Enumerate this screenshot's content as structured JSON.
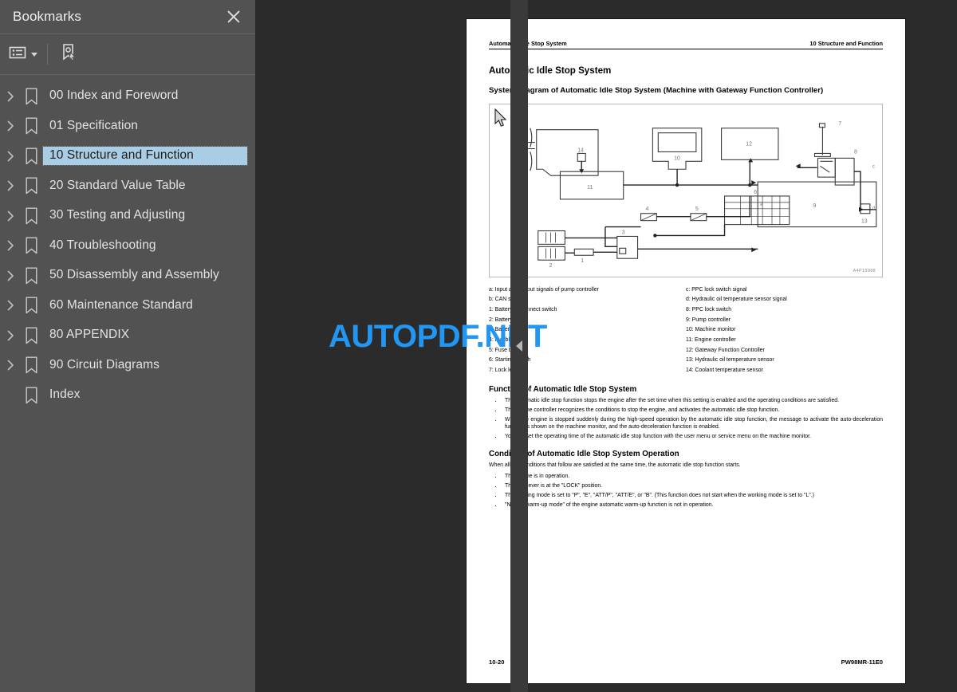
{
  "sidebar": {
    "title": "Bookmarks",
    "close_icon": "close-icon",
    "toolbar": {
      "options_label": "options-list-icon",
      "find_bookmark_label": "find-current-bookmark-icon"
    },
    "items": [
      {
        "label": "00 Index and Foreword",
        "expandable": true,
        "selected": false
      },
      {
        "label": "01 Specification",
        "expandable": true,
        "selected": false
      },
      {
        "label": "10 Structure and Function",
        "expandable": true,
        "selected": true
      },
      {
        "label": "20 Standard Value Table",
        "expandable": true,
        "selected": false
      },
      {
        "label": "30 Testing and Adjusting",
        "expandable": true,
        "selected": false
      },
      {
        "label": "40 Troubleshooting",
        "expandable": true,
        "selected": false
      },
      {
        "label": "50 Disassembly and Assembly",
        "expandable": true,
        "selected": false
      },
      {
        "label": "60 Maintenance Standard",
        "expandable": true,
        "selected": false
      },
      {
        "label": "80 APPENDIX",
        "expandable": true,
        "selected": false
      },
      {
        "label": "90 Circuit Diagrams",
        "expandable": true,
        "selected": false
      },
      {
        "label": "Index",
        "expandable": false,
        "selected": false
      }
    ]
  },
  "viewer": {
    "collapse_handle": "collapse-panel-handle",
    "watermark": "AUTOPDF.NET",
    "watermark_color": "#2196f3"
  },
  "document": {
    "running_header_left": "Automatic Idle Stop System",
    "running_header_right": "10 Structure and Function",
    "heading": "Automatic Idle Stop System",
    "subheading": "System Diagram of Automatic Idle Stop System (Machine with Gateway Function Controller)",
    "figure_code": "A4P15088",
    "legend_left": [
      "a: Input and output signals of pump controller",
      "b: CAN signal",
      "1: Battery disconnect switch",
      "2: Battery",
      "3: Battery relay",
      "4: Fusible link",
      "5: Fuse box",
      "6: Starting switch",
      "7: Lock lever"
    ],
    "legend_right": [
      "c: PPC lock switch signal",
      "d: Hydraulic oil temperature sensor signal",
      "8: PPC lock switch",
      "9: Pump controller",
      "10: Machine monitor",
      "11: Engine controller",
      "12: Gateway Function Controller",
      "13: Hydraulic oil temperature sensor",
      "14: Coolant temperature sensor"
    ],
    "function_heading": "Function of Automatic Idle Stop System",
    "function_bullets": [
      "The automatic idle stop function stops the engine after the set time when this setting is enabled and the operating conditions are satisfied.",
      "The engine controller recognizes the conditions to stop the engine, and activates the automatic idle stop function.",
      "When the engine is stopped suddenly during the high-speed operation by the automatic idle stop function, the message to activate the auto-deceleration function is shown on the machine monitor, and the auto-deceleration function is enabled.",
      "You can set the operating time of the automatic idle stop function with the user menu or service menu on the machine monitor."
    ],
    "condition_heading": "Condition of Automatic Idle Stop System Operation",
    "condition_intro": "When all the conditions that follow are satisfied at the same time, the automatic idle stop function starts.",
    "condition_bullets": [
      "The engine is in operation.",
      "The lock lever is at the \"LOCK\" position.",
      "The working mode is set to \"P\", \"E\", \"ATT/P\", \"ATT/E\", or \"B\". (This function does not start when the working mode is set to \"L\".)",
      "\"Normal warm-up mode\" of the engine automatic warm-up function is not in operation."
    ],
    "footer_left": "10-20",
    "footer_right": "PW98MR-11E0",
    "diagram_labels": [
      "1",
      "2",
      "3",
      "4",
      "5",
      "6",
      "7",
      "8",
      "9",
      "10",
      "11",
      "12",
      "13",
      "14",
      "a",
      "b",
      "c",
      "d"
    ]
  }
}
